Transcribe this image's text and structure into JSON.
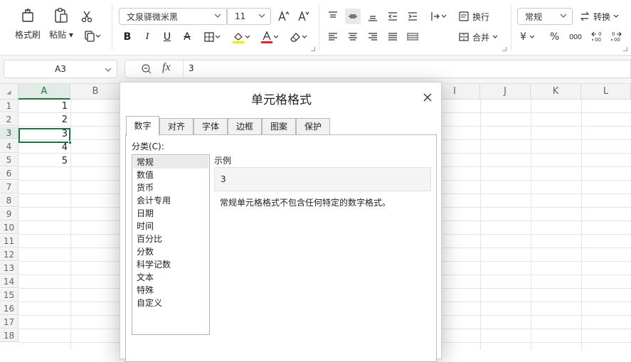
{
  "ribbon": {
    "clipboard": {
      "format_painter": "格式刷",
      "paste": "粘贴",
      "paste_arrow": "▾"
    },
    "font": {
      "name": "文泉驿微米黑",
      "size": "11"
    },
    "alignment": {
      "wrap": "换行",
      "merge": "合并"
    },
    "number": {
      "format": "常规",
      "convert": "转换",
      "currency_symbol": "¥",
      "percent": "%",
      "thousands": "000"
    },
    "accent_color": "#217346",
    "highlight_color": "#ffe600",
    "font_color": "#e0252b"
  },
  "formula_bar": {
    "name_box": "A3",
    "fx": "fx",
    "value": "3"
  },
  "grid": {
    "columns": [
      "A",
      "B",
      "I",
      "J",
      "K",
      "L"
    ],
    "rows": [
      "1",
      "2",
      "3",
      "4",
      "5",
      "6",
      "7",
      "8",
      "9",
      "10",
      "11",
      "12",
      "13",
      "14",
      "15",
      "16",
      "17",
      "18"
    ],
    "a_values": [
      "1",
      "2",
      "3",
      "4",
      "5"
    ],
    "select_all": "◢"
  },
  "dialog": {
    "title": "单元格格式",
    "tabs": [
      "数字",
      "对齐",
      "字体",
      "边框",
      "图案",
      "保护"
    ],
    "active_tab": "数字",
    "category_label": "分类(C):",
    "categories": [
      "常规",
      "数值",
      "货币",
      "会计专用",
      "日期",
      "时间",
      "百分比",
      "分数",
      "科学记数",
      "文本",
      "特殊",
      "自定义"
    ],
    "selected_category": "常规",
    "sample_label": "示例",
    "sample_value": "3",
    "description": "常规单元格格式不包含任何特定的数字格式。"
  }
}
